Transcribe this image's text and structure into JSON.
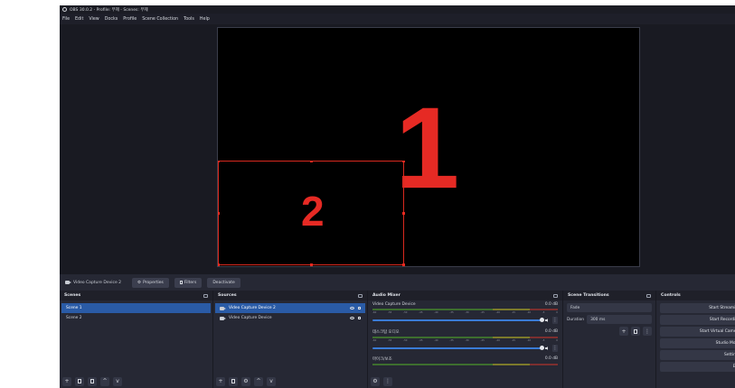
{
  "window": {
    "title": "OBS 30.0.2 - Profile: 무제 - Scenes: 무제"
  },
  "menu": [
    "File",
    "Edit",
    "View",
    "Docks",
    "Profile",
    "Scene Collection",
    "Tools",
    "Help"
  ],
  "preview": {
    "label_big": "1",
    "label_small": "2",
    "accent_color": "#e62a24"
  },
  "context_bar": {
    "source_name": "Video Capture Device 2",
    "properties": "Properties",
    "filters": "Filters",
    "deactivate": "Deactivate"
  },
  "scenes": {
    "title": "Scenes",
    "items": [
      {
        "label": "Scene 1",
        "selected": true
      },
      {
        "label": "Scene 2",
        "selected": false
      }
    ]
  },
  "sources": {
    "title": "Sources",
    "items": [
      {
        "label": "Video Capture Device 2",
        "selected": true
      },
      {
        "label": "Video Capture Device",
        "selected": false
      }
    ]
  },
  "mixer": {
    "title": "Audio Mixer",
    "channels": [
      {
        "name": "Video Capture Device",
        "db": "0.0 dB"
      },
      {
        "name": "데스크탑 오디오",
        "db": "0.0 dB"
      },
      {
        "name": "마이크/보조",
        "db": "0.0 dB"
      }
    ],
    "ticks": [
      "-60",
      "-55",
      "-50",
      "-45",
      "-40",
      "-35",
      "-30",
      "-25",
      "-20",
      "-15",
      "-10",
      "-5",
      "0"
    ]
  },
  "transitions": {
    "title": "Scene Transitions",
    "type": "Fade",
    "duration_label": "Duration",
    "duration_value": "300 ms"
  },
  "controls": {
    "title": "Controls",
    "buttons": [
      "Start Streaming",
      "Start Recording",
      "Start Virtual Camera",
      "Studio Mode",
      "Settings",
      "Exit"
    ]
  },
  "icons": {
    "add": "+",
    "remove": "🗑",
    "up": "^",
    "down": "v",
    "gear": "⚙",
    "menu": "⋮"
  }
}
